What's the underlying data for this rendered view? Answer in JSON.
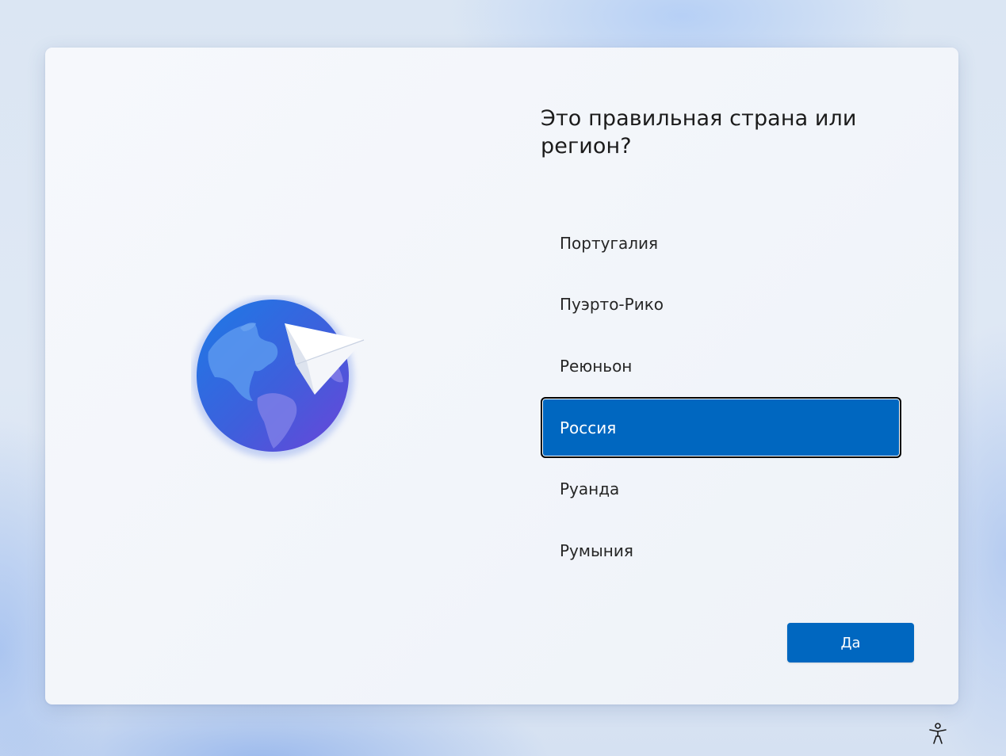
{
  "title": "Это правильная страна или регион?",
  "countries": [
    {
      "label": "Португалия",
      "selected": false
    },
    {
      "label": "Пуэрто-Рико",
      "selected": false
    },
    {
      "label": "Реюньон",
      "selected": false
    },
    {
      "label": "Россия",
      "selected": true
    },
    {
      "label": "Руанда",
      "selected": false
    },
    {
      "label": "Румыния",
      "selected": false
    }
  ],
  "buttons": {
    "yes_label": "Да"
  },
  "icons": {
    "illustration": "globe-paper-plane-icon",
    "accessibility": "accessibility-icon"
  },
  "colors": {
    "accent": "#0067c0",
    "selected_border": "#000000",
    "text": "#1b1b1b"
  }
}
